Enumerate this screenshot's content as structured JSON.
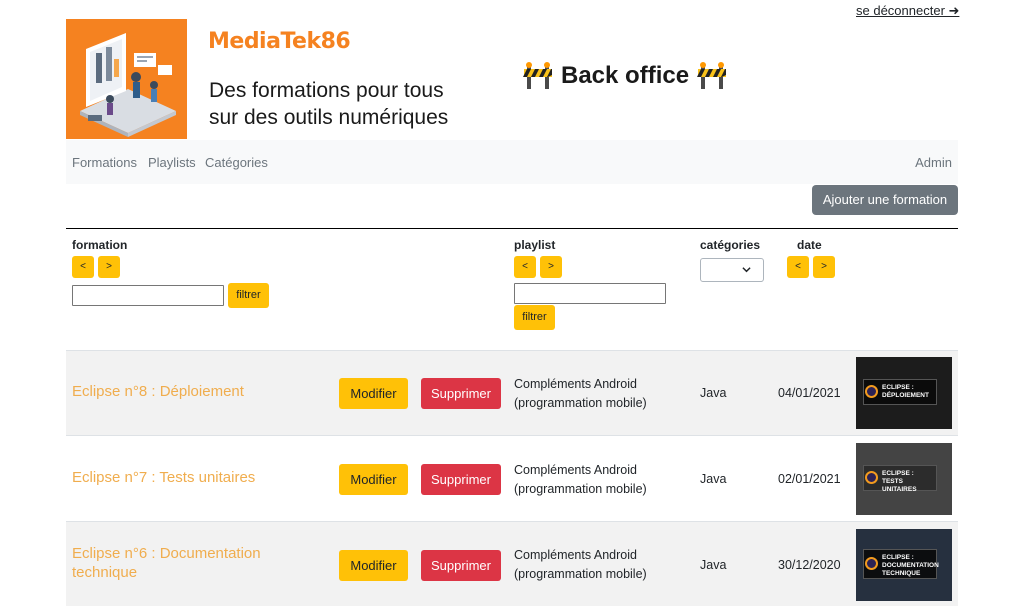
{
  "header": {
    "logout": "se déconnecter ➜",
    "site_name": "MediaTek86",
    "tagline_line1": "Des formations pour tous",
    "tagline_line2": "sur des outils numériques",
    "backoffice": "Back office",
    "barrier_icon": "construction-barrier-icon"
  },
  "nav": {
    "items": [
      "Formations",
      "Playlists",
      "Catégories"
    ],
    "admin": "Admin"
  },
  "actions": {
    "add_formation": "Ajouter une formation"
  },
  "table": {
    "headers": {
      "formation": "formation",
      "playlist": "playlist",
      "categories": "catégories",
      "date": "date"
    },
    "sort_prev": "<",
    "sort_next": ">",
    "filter_label": "filtrer",
    "rows": [
      {
        "title": "Eclipse n°8 : Déploiement",
        "playlist": "Compléments Android (programmation mobile)",
        "category": "Java",
        "date": "04/01/2021",
        "thumb": "ECLIPSE : DÉPLOIEMENT",
        "thumb_bg": "#202020"
      },
      {
        "title": "Eclipse n°7 : Tests unitaires",
        "playlist": "Compléments Android (programmation mobile)",
        "category": "Java",
        "date": "02/01/2021",
        "thumb": "ECLIPSE : TESTS UNITAIRES",
        "thumb_bg": "#3a3a3a"
      },
      {
        "title": "Eclipse n°6 : Documentation technique",
        "playlist": "Compléments Android (programmation mobile)",
        "category": "Java",
        "date": "30/12/2020",
        "thumb": "ECLIPSE : DOCUMENTATION TECHNIQUE",
        "thumb_bg": "#263040"
      }
    ],
    "modify_label": "Modifier",
    "delete_label": "Supprimer"
  },
  "colors": {
    "brand": "#f58220",
    "accent": "#ffc107",
    "danger": "#dc3545",
    "secondary": "#6c757d",
    "title_link": "#f0ad4e"
  }
}
